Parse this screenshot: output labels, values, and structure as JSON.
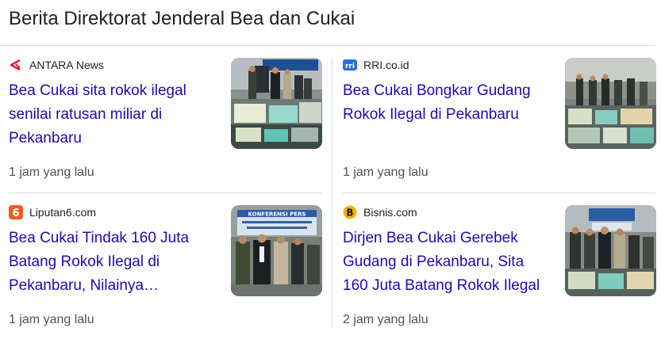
{
  "section": {
    "title": "Berita Direktorat Jenderal Bea dan Cukai"
  },
  "articles": [
    {
      "source": "ANTARA News",
      "favicon": "antara-icon",
      "headline_lines": [
        "Bea Cukai sita rokok ilegal",
        "senilai ratusan miliar di",
        "Pekanbaru"
      ],
      "time": "1 jam yang lalu",
      "thumb_banner": "",
      "thumb_icon": "news-photo-thumbnail"
    },
    {
      "source": "RRI.co.id",
      "favicon": "rri-icon",
      "headline_lines": [
        "Bea Cukai Bongkar Gudang",
        "Rokok Ilegal di Pekanbaru"
      ],
      "time": "1 jam yang lalu",
      "thumb_banner": "",
      "thumb_icon": "news-photo-thumbnail"
    },
    {
      "source": "Liputan6.com",
      "favicon": "liputan6-icon",
      "headline_lines": [
        "Bea Cukai Tindak 160 Juta",
        "Batang Rokok Ilegal di",
        "Pekanbaru, Nilainya…"
      ],
      "time": "1 jam yang lalu",
      "thumb_banner": "KONFERENSI PERS",
      "thumb_icon": "news-photo-thumbnail"
    },
    {
      "source": "Bisnis.com",
      "favicon": "bisnis-icon",
      "headline_lines": [
        "Dirjen Bea Cukai Gerebek",
        "Gudang di Pekanbaru, Sita",
        "160 Juta Batang Rokok Ilegal"
      ],
      "time": "2 jam yang lalu",
      "thumb_banner": "",
      "thumb_icon": "news-photo-thumbnail"
    }
  ],
  "colors": {
    "link": "#1a0dab",
    "text": "#202124",
    "meta": "#4d5156",
    "divider": "#dadce0",
    "antara": "#e0223b",
    "rri": "#2d6fd8",
    "liputan6": "#f05a22",
    "bisnis": "#f2b300"
  }
}
